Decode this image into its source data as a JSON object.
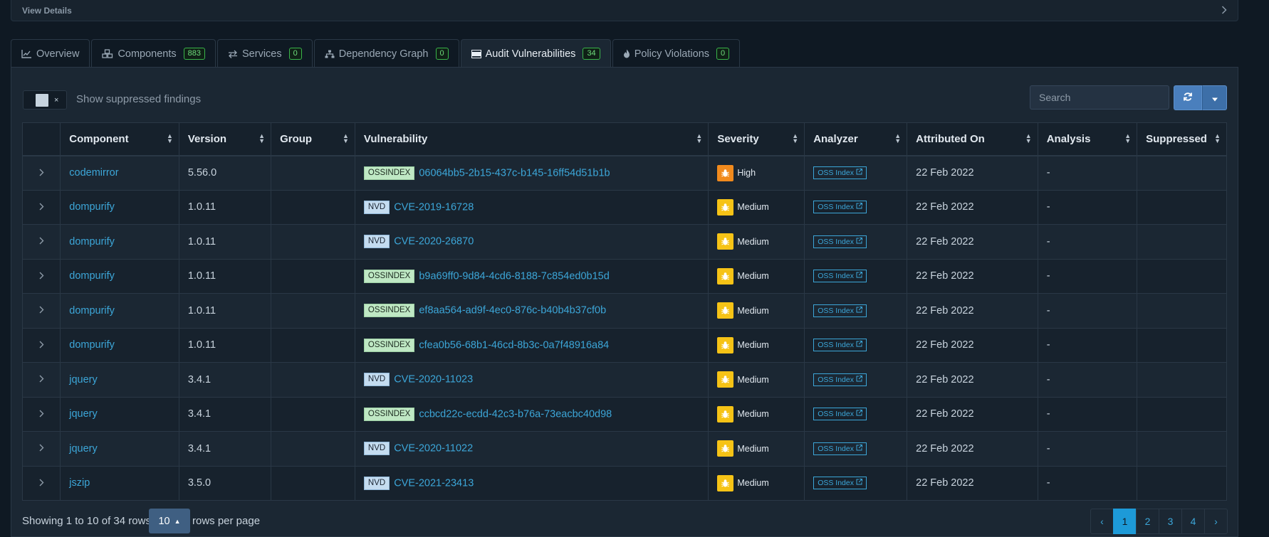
{
  "header": {
    "view_details": "View Details"
  },
  "tabs": [
    {
      "label": "Overview",
      "icon": "line-chart-icon"
    },
    {
      "label": "Components",
      "icon": "cubes-icon",
      "count": "883"
    },
    {
      "label": "Services",
      "icon": "exchange-icon",
      "count": "0"
    },
    {
      "label": "Dependency Graph",
      "icon": "sitemap-icon",
      "count": "0"
    },
    {
      "label": "Audit Vulnerabilities",
      "icon": "tasks-icon",
      "count": "34",
      "active": true
    },
    {
      "label": "Policy Violations",
      "icon": "fire-icon",
      "count": "0"
    }
  ],
  "toolbar": {
    "toggle_x": "×",
    "suppressed_label": "Show suppressed findings",
    "search_placeholder": "Search"
  },
  "table": {
    "columns": [
      "Component",
      "Version",
      "Group",
      "Vulnerability",
      "Severity",
      "Analyzer",
      "Attributed On",
      "Analysis",
      "Suppressed"
    ],
    "rows": [
      {
        "component": "codemirror",
        "version": "5.56.0",
        "group": "",
        "source": "OSSINDEX",
        "vuln": "06064bb5-2b15-437c-b145-16ff54d51b1b",
        "severity": "High",
        "analyzer": "OSS Index",
        "attributed": "22 Feb 2022",
        "analysis": "-",
        "suppressed": ""
      },
      {
        "component": "dompurify",
        "version": "1.0.11",
        "group": "",
        "source": "NVD",
        "vuln": "CVE-2019-16728",
        "severity": "Medium",
        "analyzer": "OSS Index",
        "attributed": "22 Feb 2022",
        "analysis": "-",
        "suppressed": ""
      },
      {
        "component": "dompurify",
        "version": "1.0.11",
        "group": "",
        "source": "NVD",
        "vuln": "CVE-2020-26870",
        "severity": "Medium",
        "analyzer": "OSS Index",
        "attributed": "22 Feb 2022",
        "analysis": "-",
        "suppressed": ""
      },
      {
        "component": "dompurify",
        "version": "1.0.11",
        "group": "",
        "source": "OSSINDEX",
        "vuln": "b9a69ff0-9d84-4cd6-8188-7c854ed0b15d",
        "severity": "Medium",
        "analyzer": "OSS Index",
        "attributed": "22 Feb 2022",
        "analysis": "-",
        "suppressed": ""
      },
      {
        "component": "dompurify",
        "version": "1.0.11",
        "group": "",
        "source": "OSSINDEX",
        "vuln": "ef8aa564-ad9f-4ec0-876c-b40b4b37cf0b",
        "severity": "Medium",
        "analyzer": "OSS Index",
        "attributed": "22 Feb 2022",
        "analysis": "-",
        "suppressed": ""
      },
      {
        "component": "dompurify",
        "version": "1.0.11",
        "group": "",
        "source": "OSSINDEX",
        "vuln": "cfea0b56-68b1-46cd-8b3c-0a7f48916a84",
        "severity": "Medium",
        "analyzer": "OSS Index",
        "attributed": "22 Feb 2022",
        "analysis": "-",
        "suppressed": ""
      },
      {
        "component": "jquery",
        "version": "3.4.1",
        "group": "",
        "source": "NVD",
        "vuln": "CVE-2020-11023",
        "severity": "Medium",
        "analyzer": "OSS Index",
        "attributed": "22 Feb 2022",
        "analysis": "-",
        "suppressed": ""
      },
      {
        "component": "jquery",
        "version": "3.4.1",
        "group": "",
        "source": "OSSINDEX",
        "vuln": "ccbcd22c-ecdd-42c3-b76a-73eacbc40d98",
        "severity": "Medium",
        "analyzer": "OSS Index",
        "attributed": "22 Feb 2022",
        "analysis": "-",
        "suppressed": ""
      },
      {
        "component": "jquery",
        "version": "3.4.1",
        "group": "",
        "source": "NVD",
        "vuln": "CVE-2020-11022",
        "severity": "Medium",
        "analyzer": "OSS Index",
        "attributed": "22 Feb 2022",
        "analysis": "-",
        "suppressed": ""
      },
      {
        "component": "jszip",
        "version": "3.5.0",
        "group": "",
        "source": "NVD",
        "vuln": "CVE-2021-23413",
        "severity": "Medium",
        "analyzer": "OSS Index",
        "attributed": "22 Feb 2022",
        "analysis": "-",
        "suppressed": ""
      }
    ]
  },
  "footer": {
    "showing": "Showing 1 to 10 of 34 rows",
    "rows_per_page_value": "10",
    "rows_per_page_label": "rows per page",
    "pages": [
      "‹",
      "1",
      "2",
      "3",
      "4",
      "›"
    ],
    "active_page": "1"
  },
  "colors": {
    "severity_high": "#f18a1d",
    "severity_medium": "#f6c316",
    "link": "#3ca6d8",
    "badge": "#3ab54a"
  }
}
